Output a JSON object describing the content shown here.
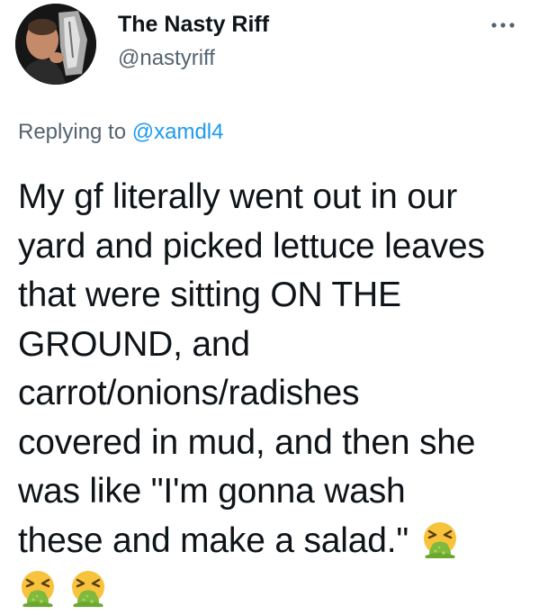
{
  "tweet": {
    "author": {
      "display_name": "The Nasty Riff",
      "handle": "@nastyriff"
    },
    "reply_prefix": "Replying to",
    "reply_to": "@xamdl4",
    "lines": [
      "My gf literally went out in our",
      "yard and picked lettuce leaves",
      "that were sitting ON THE",
      "GROUND, and",
      "carrot/onions/radishes",
      "covered in mud, and then she",
      "was like \"I'm gonna wash",
      "these and make a salad.\""
    ],
    "emojis": [
      "face-vomiting",
      "face-vomiting",
      "face-vomiting"
    ]
  },
  "colors": {
    "text": "#0f1419",
    "secondary": "#536471",
    "link": "#1d9bf0",
    "emoji_face": "#f7c23c",
    "emoji_vomit": "#7fb93e"
  }
}
